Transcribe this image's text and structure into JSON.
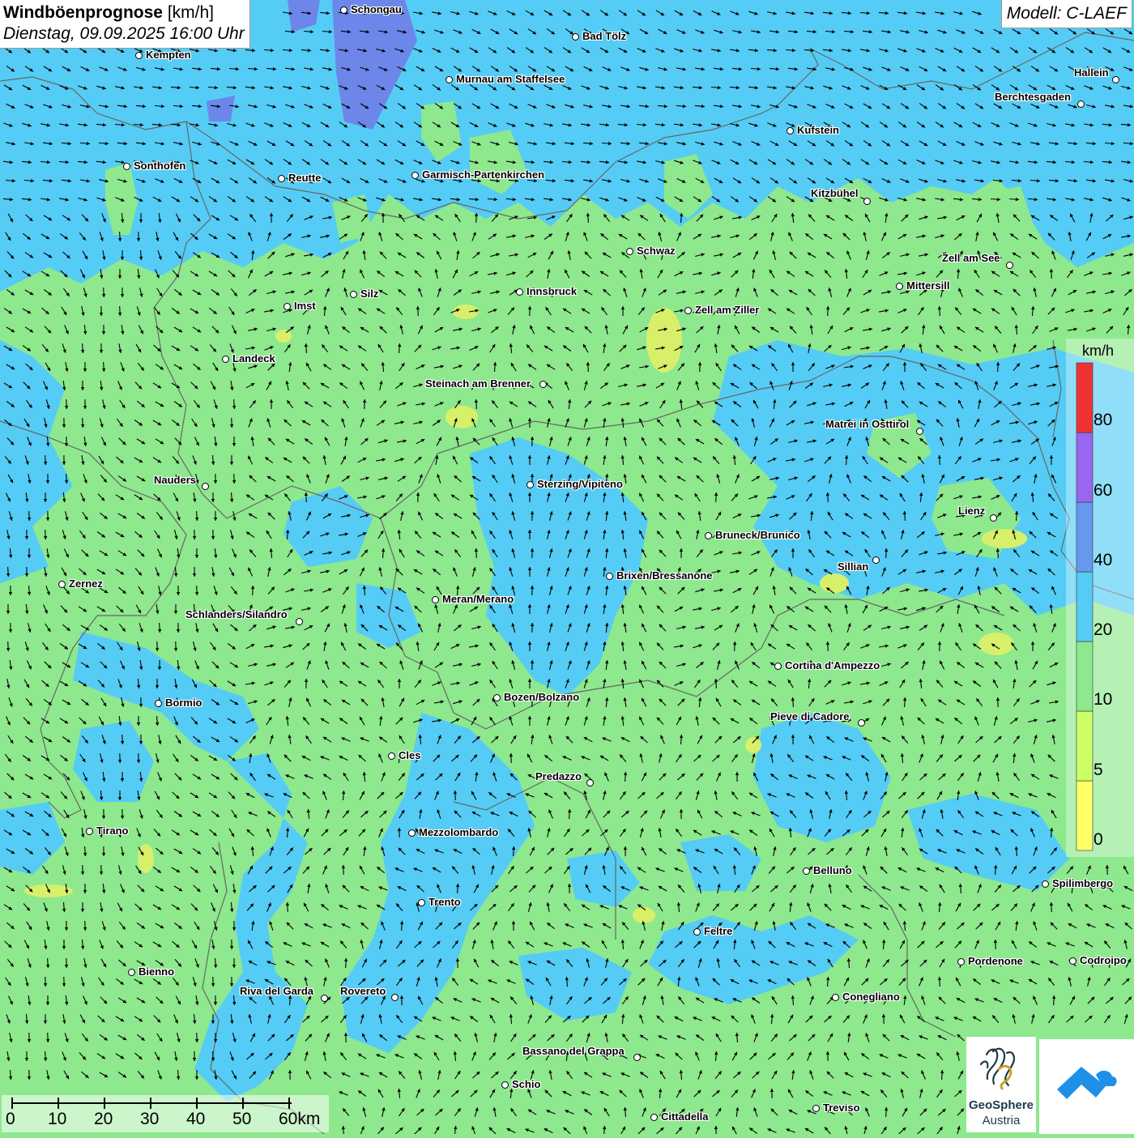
{
  "header": {
    "title_bold": "Windböenprognose",
    "title_unit": "[km/h]",
    "datetime": "Dienstag, 09.09.2025 16:00 Uhr"
  },
  "model_label": "Modell: C-LAEF",
  "legend": {
    "unit": "km/h",
    "stops": [
      {
        "value": "0",
        "color": "#ffff66"
      },
      {
        "value": "5",
        "color": "#ccff66"
      },
      {
        "value": "10",
        "color": "#8ee88e"
      },
      {
        "value": "20",
        "color": "#55ccf5"
      },
      {
        "value": "40",
        "color": "#6699ee"
      },
      {
        "value": "60",
        "color": "#9966ee"
      },
      {
        "value": "80",
        "color": "#ee3333"
      }
    ]
  },
  "scale": {
    "ticks": [
      "0",
      "10",
      "20",
      "30",
      "40",
      "50",
      "60km"
    ]
  },
  "colors": {
    "calm_green": "#8ee88e",
    "wind_blue": "#55ccf5",
    "wind_purple": "#6f7fe8",
    "calm_yellow": "#d8ef6a",
    "border_gray": "#666666"
  },
  "logos": {
    "geosphere_line1": "GeoSphere",
    "geosphere_line2": "Austria"
  },
  "cities": [
    {
      "name": "Schongau"
    },
    {
      "name": "Bad Tölz"
    },
    {
      "name": "Kempten"
    },
    {
      "name": "Murnau am Staffelsee"
    },
    {
      "name": "Hallein"
    },
    {
      "name": "Berchtesgaden"
    },
    {
      "name": "Kufstein"
    },
    {
      "name": "Sonthofen"
    },
    {
      "name": "Reutte"
    },
    {
      "name": "Garmisch-Partenkirchen"
    },
    {
      "name": "Kitzbühel"
    },
    {
      "name": "Schwaz"
    },
    {
      "name": "Zell am See"
    },
    {
      "name": "Mittersill"
    },
    {
      "name": "Silz"
    },
    {
      "name": "Innsbruck"
    },
    {
      "name": "Imst"
    },
    {
      "name": "Zell am Ziller"
    },
    {
      "name": "Landeck"
    },
    {
      "name": "Steinach am Brenner"
    },
    {
      "name": "Matrei in Osttirol"
    },
    {
      "name": "Nauders"
    },
    {
      "name": "Sterzing/Vipiteno"
    },
    {
      "name": "Lienz"
    },
    {
      "name": "Bruneck/Brunico"
    },
    {
      "name": "Sillian"
    },
    {
      "name": "Brixen/Bressanone"
    },
    {
      "name": "Zernez"
    },
    {
      "name": "Meran/Merano"
    },
    {
      "name": "Schlanders/Silandro"
    },
    {
      "name": "Cortina d'Ampezzo"
    },
    {
      "name": "Bozen/Bolzano"
    },
    {
      "name": "Bormio"
    },
    {
      "name": "Pieve di Cadore"
    },
    {
      "name": "Cles"
    },
    {
      "name": "Predazzo"
    },
    {
      "name": "Tirano"
    },
    {
      "name": "Mezzolombardo"
    },
    {
      "name": "Belluno"
    },
    {
      "name": "Spilimbergo"
    },
    {
      "name": "Trento"
    },
    {
      "name": "Feltre"
    },
    {
      "name": "Bienno"
    },
    {
      "name": "Pordenone"
    },
    {
      "name": "Codroipo"
    },
    {
      "name": "Riva del Garda"
    },
    {
      "name": "Rovereto"
    },
    {
      "name": "Conegliano"
    },
    {
      "name": "Bassano del Grappa"
    },
    {
      "name": "Schio"
    },
    {
      "name": "Treviso"
    },
    {
      "name": "Cittadella"
    }
  ]
}
